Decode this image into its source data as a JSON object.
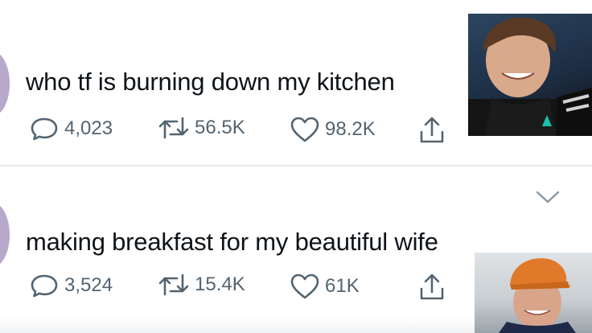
{
  "tweets": [
    {
      "text": "who tf is burning down my kitchen",
      "replies": "4,023",
      "retweets": "56.5K",
      "likes": "98.2K"
    },
    {
      "text": "making breakfast for my beautiful wife",
      "replies": "3,524",
      "retweets": "15.4K",
      "likes": "61K"
    }
  ],
  "icons": {
    "reply": "reply-icon",
    "retweet": "retweet-icon",
    "like": "heart-icon",
    "share": "share-icon",
    "more": "chevron-down-icon"
  },
  "colors": {
    "text": "#0f1419",
    "muted": "#536471",
    "avatar": "#b8a8cc",
    "divider": "#e6e9ec"
  }
}
